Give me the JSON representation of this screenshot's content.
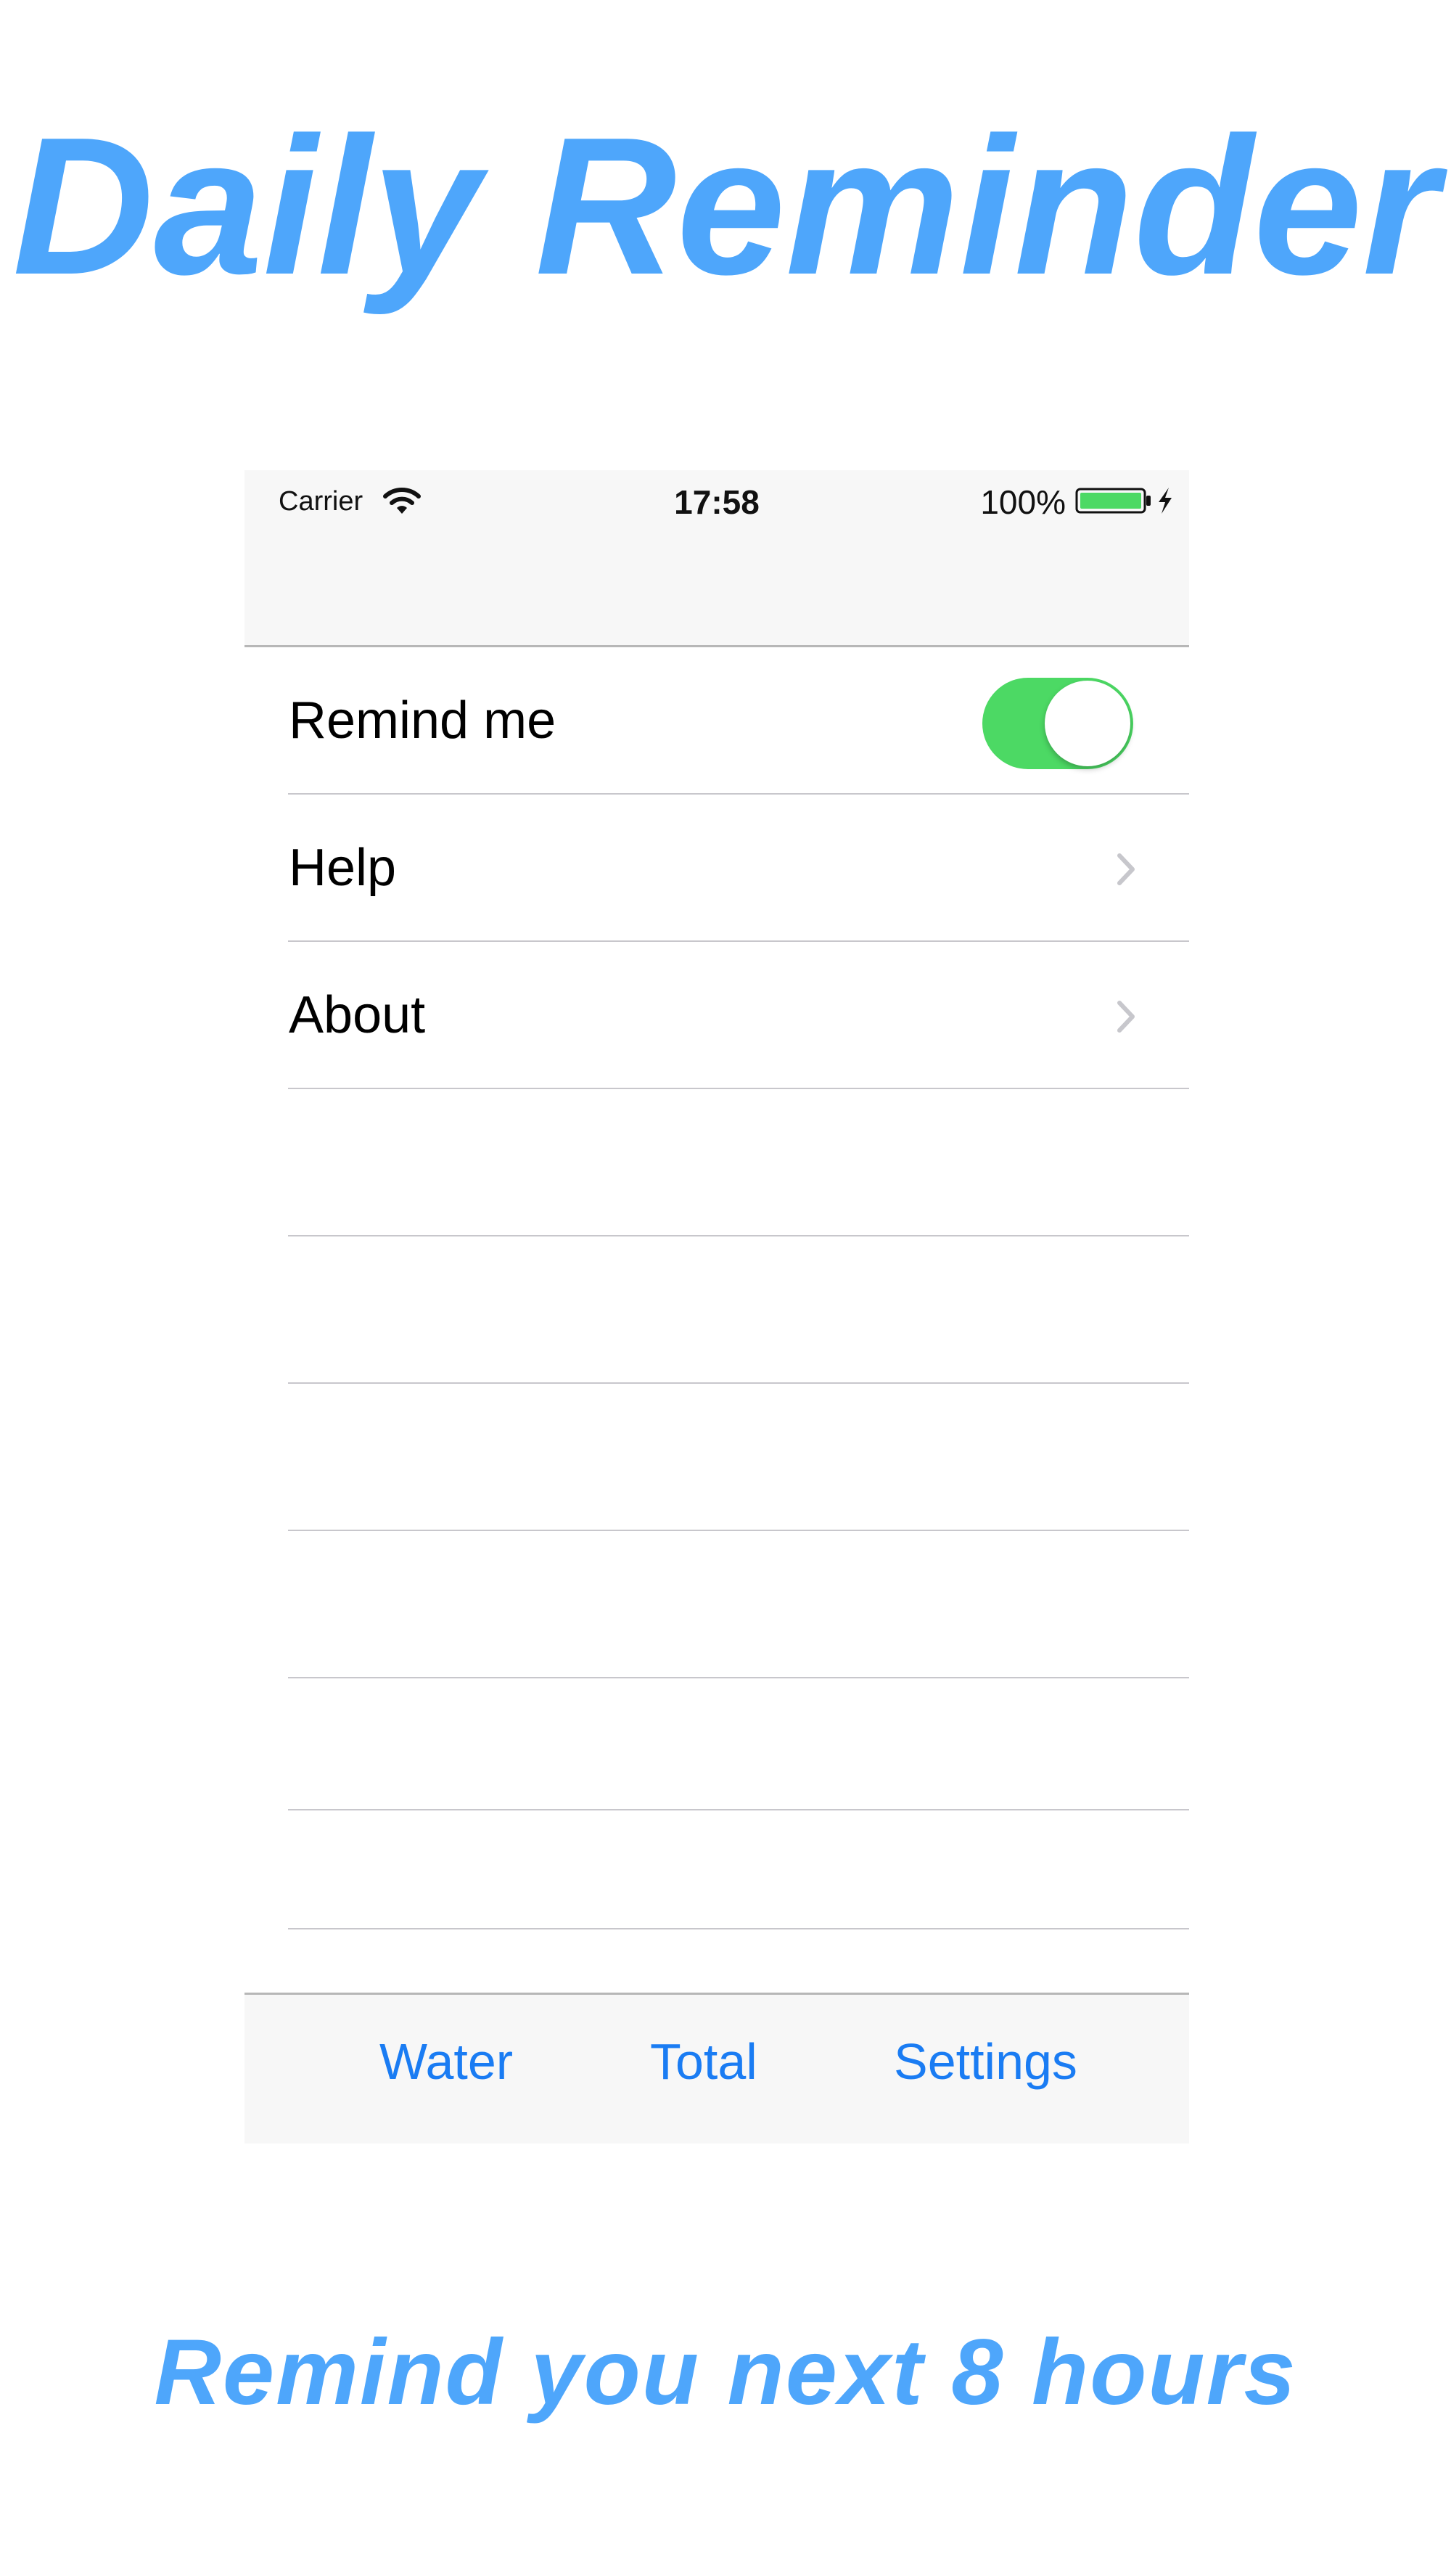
{
  "promo": {
    "title": "Daily Reminder",
    "subtitle": "Remind you next 8 hours",
    "accent_color": "#4ea6fb"
  },
  "status_bar": {
    "carrier": "Carrier",
    "time": "17:58",
    "battery_percent": "100%",
    "icons": [
      "wifi-icon",
      "battery-icon",
      "charging-bolt-icon"
    ]
  },
  "settings_list": {
    "items": [
      {
        "label": "Remind me",
        "control": "toggle",
        "toggle_on": true
      },
      {
        "label": "Help",
        "control": "chevron"
      },
      {
        "label": "About",
        "control": "chevron"
      }
    ],
    "empty_rows": 6
  },
  "tab_bar": {
    "tabs": [
      {
        "label": "Water"
      },
      {
        "label": "Total"
      },
      {
        "label": "Settings"
      }
    ],
    "tint_color": "#1a7cf3"
  },
  "colors": {
    "toggle_on": "#4cd964",
    "separator": "#c8c7cc",
    "bar_background": "#f7f7f7"
  }
}
